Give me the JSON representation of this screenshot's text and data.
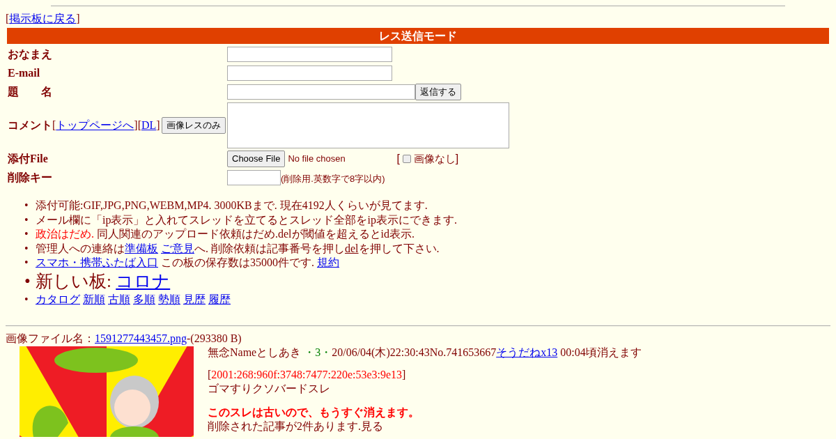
{
  "back_link": {
    "open": "[",
    "text": "掲示板に戻る",
    "close": "]"
  },
  "form": {
    "title": "レス送信モード",
    "name_label": "おなまえ",
    "email_label": "E-mail",
    "subject_label": "題　　名",
    "submit": "返信する",
    "comment_label": "コメント",
    "comment_brackets": [
      "[",
      "][",
      "]"
    ],
    "comment_links": [
      "トップページへ",
      "DL"
    ],
    "image_only_button": "画像レスのみ",
    "file_label": "添付File",
    "file_button": "Choose File",
    "file_status": "No file chosen",
    "no_image": {
      "open": "[",
      "label": "画像なし",
      "close": "]",
      "checked": false
    },
    "delete_label": "削除キー",
    "delete_hint": "(削除用.英数字で8字以内)"
  },
  "notices": [
    {
      "marker": "•",
      "large": false,
      "parts": [
        {
          "kind": "text",
          "text": "添付可能:GIF,JPG,PNG,WEBM,MP4. 3000KBまで. 現在4192人くらいが見てます."
        }
      ]
    },
    {
      "marker": "•",
      "large": false,
      "parts": [
        {
          "kind": "text",
          "text": "メール欄に「ip表示」と入れてスレッドを立てるとスレッド全部をip表示にできます."
        }
      ]
    },
    {
      "marker": "•",
      "large": false,
      "parts": [
        {
          "kind": "alert",
          "text": "政治はだめ."
        },
        {
          "kind": "text",
          "text": " 同人関連のアップロード依頼はだめ.delが閾値を超えるとid表示."
        }
      ]
    },
    {
      "marker": "•",
      "large": false,
      "parts": [
        {
          "kind": "text",
          "text": "管理人への連絡は"
        },
        {
          "kind": "link",
          "text": "準備板"
        },
        {
          "kind": "link",
          "text": "ご意見"
        },
        {
          "kind": "text",
          "text": "へ. 削除依頼は記事番号を押し"
        },
        {
          "kind": "underline",
          "text": "del"
        },
        {
          "kind": "text",
          "text": "を押して下さい."
        }
      ]
    },
    {
      "marker": "•",
      "large": false,
      "parts": [
        {
          "kind": "link",
          "text": "スマホ・携帯ふたば入口"
        },
        {
          "kind": "text",
          "text": " この板の保存数は35000件です. "
        },
        {
          "kind": "link",
          "text": "規約"
        }
      ]
    },
    {
      "marker": "•",
      "large": true,
      "parts": [
        {
          "kind": "text",
          "text": "新しい板: "
        },
        {
          "kind": "link",
          "text": "コロナ"
        }
      ]
    },
    {
      "marker": "•",
      "large": false,
      "parts": [
        {
          "kind": "link",
          "text": "カタログ"
        },
        {
          "kind": "link",
          "text": "新順"
        },
        {
          "kind": "link",
          "text": "古順"
        },
        {
          "kind": "link",
          "text": "多順"
        },
        {
          "kind": "link",
          "text": "勢順"
        },
        {
          "kind": "link",
          "text": "見歴"
        },
        {
          "kind": "link",
          "text": "履歴"
        }
      ]
    }
  ],
  "post": {
    "file_prefix": "画像ファイル名：",
    "file_name": "1591277443457.png",
    "file_size": "-(293380 B)",
    "meta": [
      {
        "kind": "text",
        "text": "無念Nameとしあき "
      },
      {
        "kind": "count",
        "text": "・3・"
      },
      {
        "kind": "text",
        "text": "20/06/04(木)22:30:43No.741653667"
      },
      {
        "kind": "link",
        "text": "そうだねx13"
      },
      {
        "kind": "text",
        "text": " 00:04頃消えます"
      }
    ],
    "ip": {
      "open": "[",
      "text": "2001:268:960f:3748:7477:220e:53e3:9e13",
      "close": "]"
    },
    "body": "ゴマすりクソバードスレ",
    "warning": "このスレは古いので、もうすぐ消えます。",
    "deleted_note": "削除された記事が2件あります.見る"
  }
}
